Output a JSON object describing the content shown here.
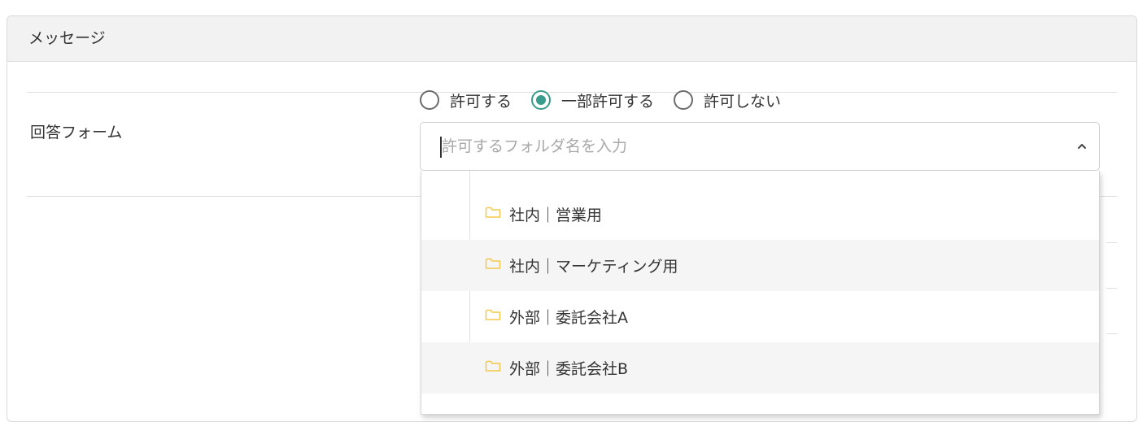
{
  "panel": {
    "title": "メッセージ"
  },
  "form_row": {
    "label": "回答フォーム",
    "radio_options": [
      {
        "label": "許可する",
        "checked": false
      },
      {
        "label": "一部許可する",
        "checked": true
      },
      {
        "label": "許可しない",
        "checked": false
      }
    ],
    "folder_search": {
      "value": "",
      "placeholder": "許可するフォルダ名を入力"
    }
  },
  "dropdown": {
    "items": [
      {
        "label": "社内｜営業用",
        "icon": "folder-icon"
      },
      {
        "label": "社内｜マーケティング用",
        "icon": "folder-icon"
      },
      {
        "label": "外部｜委託会社A",
        "icon": "folder-icon"
      },
      {
        "label": "外部｜委託会社B",
        "icon": "folder-icon"
      }
    ]
  },
  "colors": {
    "accent": "#3a9c8c",
    "folder": "#f2c94c",
    "header_bg": "#f2f2f2"
  }
}
